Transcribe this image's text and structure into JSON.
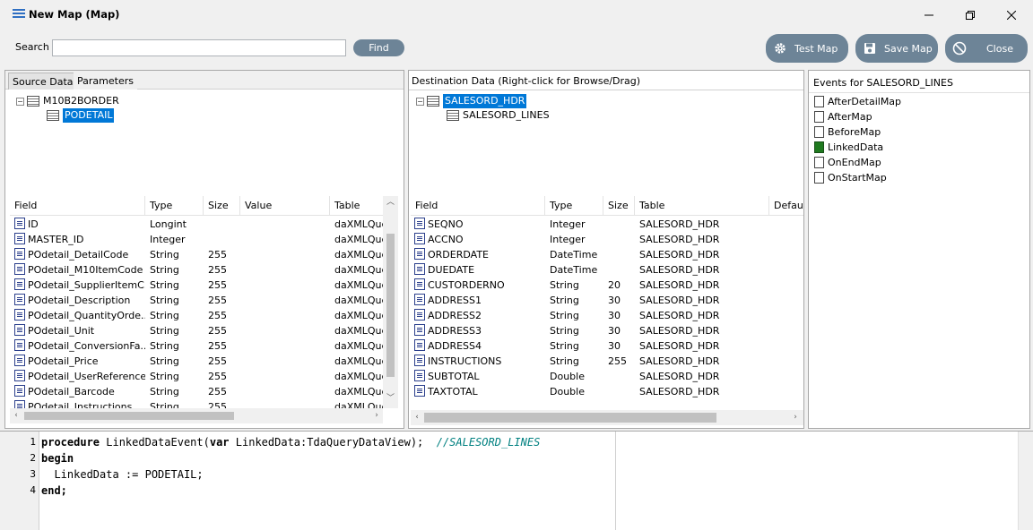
{
  "window": {
    "title": "New Map (Map)"
  },
  "toolbar": {
    "search_label": "Search",
    "search_value": "",
    "find_label": "Find",
    "test_map_label": "Test Map",
    "save_map_label": "Save Map",
    "close_label": "Close"
  },
  "source": {
    "tabs": [
      "Source Data",
      "Parameters"
    ],
    "tree": {
      "root": "M10B2BORDER",
      "child": "PODETAIL"
    },
    "columns": [
      "Field",
      "Type",
      "Size",
      "Value",
      "Table"
    ],
    "rows": [
      {
        "field": "ID",
        "type": "Longint",
        "size": "",
        "value": "",
        "table": "daXMLQuery"
      },
      {
        "field": "MASTER_ID",
        "type": "Integer",
        "size": "",
        "value": "",
        "table": "daXMLQuery"
      },
      {
        "field": "POdetail_DetailCode",
        "type": "String",
        "size": "255",
        "value": "",
        "table": "daXMLQuery"
      },
      {
        "field": "POdetail_M10ItemCode",
        "type": "String",
        "size": "255",
        "value": "",
        "table": "daXMLQuery"
      },
      {
        "field": "POdetail_SupplierItemC...",
        "type": "String",
        "size": "255",
        "value": "",
        "table": "daXMLQuery"
      },
      {
        "field": "POdetail_Description",
        "type": "String",
        "size": "255",
        "value": "",
        "table": "daXMLQuery"
      },
      {
        "field": "POdetail_QuantityOrde...",
        "type": "String",
        "size": "255",
        "value": "",
        "table": "daXMLQuery"
      },
      {
        "field": "POdetail_Unit",
        "type": "String",
        "size": "255",
        "value": "",
        "table": "daXMLQuery"
      },
      {
        "field": "POdetail_ConversionFa...",
        "type": "String",
        "size": "255",
        "value": "",
        "table": "daXMLQuery"
      },
      {
        "field": "POdetail_Price",
        "type": "String",
        "size": "255",
        "value": "",
        "table": "daXMLQuery"
      },
      {
        "field": "POdetail_UserReference",
        "type": "String",
        "size": "255",
        "value": "",
        "table": "daXMLQuery"
      },
      {
        "field": "POdetail_Barcode",
        "type": "String",
        "size": "255",
        "value": "",
        "table": "daXMLQuery"
      },
      {
        "field": "POdetail_Instructions",
        "type": "String",
        "size": "255",
        "value": "",
        "table": "daXMLQuery"
      }
    ]
  },
  "destination": {
    "header": "Destination Data  (Right-click for Browse/Drag)",
    "tree": {
      "root": "SALESORD_HDR",
      "child": "SALESORD_LINES"
    },
    "columns": [
      "Field",
      "Type",
      "Size",
      "Table",
      "Default"
    ],
    "rows": [
      {
        "field": "SEQNO",
        "type": "Integer",
        "size": "",
        "table": "SALESORD_HDR"
      },
      {
        "field": "ACCNO",
        "type": "Integer",
        "size": "",
        "table": "SALESORD_HDR"
      },
      {
        "field": "ORDERDATE",
        "type": "DateTime",
        "size": "",
        "table": "SALESORD_HDR"
      },
      {
        "field": "DUEDATE",
        "type": "DateTime",
        "size": "",
        "table": "SALESORD_HDR"
      },
      {
        "field": "CUSTORDERNO",
        "type": "String",
        "size": "20",
        "table": "SALESORD_HDR"
      },
      {
        "field": "ADDRESS1",
        "type": "String",
        "size": "30",
        "table": "SALESORD_HDR"
      },
      {
        "field": "ADDRESS2",
        "type": "String",
        "size": "30",
        "table": "SALESORD_HDR"
      },
      {
        "field": "ADDRESS3",
        "type": "String",
        "size": "30",
        "table": "SALESORD_HDR"
      },
      {
        "field": "ADDRESS4",
        "type": "String",
        "size": "30",
        "table": "SALESORD_HDR"
      },
      {
        "field": "INSTRUCTIONS",
        "type": "String",
        "size": "255",
        "table": "SALESORD_HDR"
      },
      {
        "field": "SUBTOTAL",
        "type": "Double",
        "size": "",
        "table": "SALESORD_HDR"
      },
      {
        "field": "TAXTOTAL",
        "type": "Double",
        "size": "",
        "table": "SALESORD_HDR"
      }
    ]
  },
  "events": {
    "header": "Events for SALESORD_LINES",
    "items": [
      {
        "name": "AfterDetailMap",
        "has_code": false
      },
      {
        "name": "AfterMap",
        "has_code": false
      },
      {
        "name": "BeforeMap",
        "has_code": false
      },
      {
        "name": "LinkedData",
        "has_code": true
      },
      {
        "name": "OnEndMap",
        "has_code": false
      },
      {
        "name": "OnStartMap",
        "has_code": false
      }
    ]
  },
  "code": {
    "line_numbers": [
      "1",
      "2",
      "3",
      "4"
    ],
    "line1_kw": "procedure",
    "line1_rest": " LinkedDataEvent(",
    "line1_kw2": "var",
    "line1_rest2": " LinkedData:TdaQueryDataView);  ",
    "line1_comment": "//SALESORD_LINES",
    "line2": "begin",
    "line3": "  LinkedData := PODETAIL;",
    "line4": "end;"
  }
}
